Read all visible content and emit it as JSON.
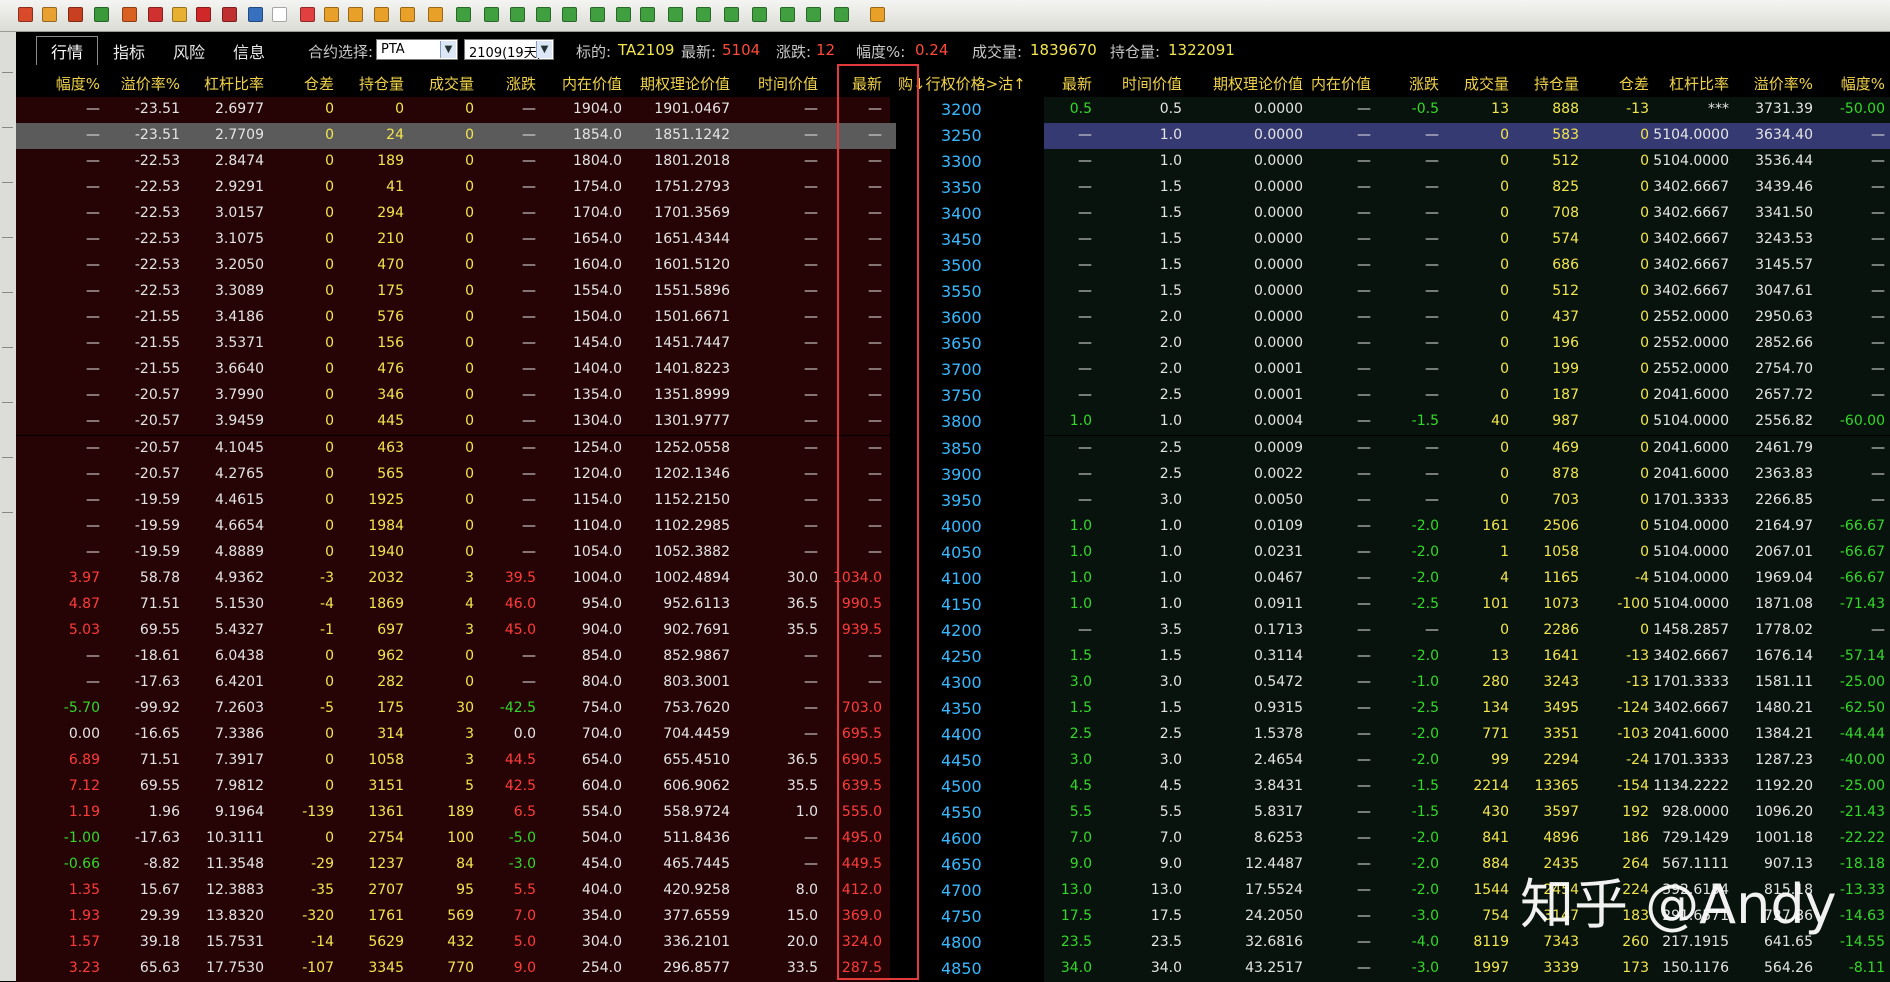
{
  "tabs": [
    "行情",
    "指标",
    "风险",
    "信息"
  ],
  "contract_select": {
    "label": "合约选择:",
    "value": "PTA",
    "expiry": "2109(19天)"
  },
  "underlying": {
    "label": "标的:",
    "value": "TA2109"
  },
  "latest": {
    "label": "最新:",
    "value": "5104"
  },
  "change": {
    "label": "涨跌:",
    "value": "12"
  },
  "amplitude": {
    "label": "幅度%:",
    "value": "0.24"
  },
  "volume": {
    "label": "成交量:",
    "value": "1839670"
  },
  "open_interest": {
    "label": "持仓量:",
    "value": "1322091"
  },
  "colors": {
    "accent_blue": "#38b8ff",
    "header_yellow": "#f3e64e",
    "up_red": "#ff3c3c",
    "down_green": "#34d82a",
    "call_bg": "#260405",
    "put_bg": "#07130c",
    "highlight_box": "#e23a3a"
  },
  "headers": {
    "call": [
      "幅度%",
      "溢价率%",
      "杠杆比率",
      "仓差",
      "持仓量",
      "成交量",
      "涨跌",
      "内在价值",
      "期权理论价值",
      "时间价值",
      "最新"
    ],
    "middle": "购↓行权价格>沽↑",
    "put": [
      "最新",
      "时间价值",
      "期权理论价值",
      "内在价值",
      "涨跌",
      "成交量",
      "持仓量",
      "仓差",
      "杠杆比率",
      "溢价率%",
      "幅度%"
    ]
  },
  "rows": [
    {
      "strike": "3200",
      "call": [
        "—",
        "-23.51",
        "2.6977",
        "0",
        "0",
        "0",
        "—",
        "1904.0",
        "1901.0467",
        "—",
        "—"
      ],
      "put": [
        "0.5",
        "0.5",
        "0.0000",
        "—",
        "-0.5",
        "13",
        "888",
        "-13",
        "***",
        "3731.39",
        "-50.00"
      ]
    },
    {
      "strike": "3250",
      "call": [
        "—",
        "-23.51",
        "2.7709",
        "0",
        "24",
        "0",
        "—",
        "1854.0",
        "1851.1242",
        "—",
        "—"
      ],
      "put": [
        "—",
        "1.0",
        "0.0000",
        "—",
        "—",
        "0",
        "583",
        "0",
        "5104.0000",
        "3634.40",
        "—"
      ]
    },
    {
      "strike": "3300",
      "call": [
        "—",
        "-22.53",
        "2.8474",
        "0",
        "189",
        "0",
        "—",
        "1804.0",
        "1801.2018",
        "—",
        "—"
      ],
      "put": [
        "—",
        "1.0",
        "0.0000",
        "—",
        "—",
        "0",
        "512",
        "0",
        "5104.0000",
        "3536.44",
        "—"
      ]
    },
    {
      "strike": "3350",
      "call": [
        "—",
        "-22.53",
        "2.9291",
        "0",
        "41",
        "0",
        "—",
        "1754.0",
        "1751.2793",
        "—",
        "—"
      ],
      "put": [
        "—",
        "1.5",
        "0.0000",
        "—",
        "—",
        "0",
        "825",
        "0",
        "3402.6667",
        "3439.46",
        "—"
      ]
    },
    {
      "strike": "3400",
      "call": [
        "—",
        "-22.53",
        "3.0157",
        "0",
        "294",
        "0",
        "—",
        "1704.0",
        "1701.3569",
        "—",
        "—"
      ],
      "put": [
        "—",
        "1.5",
        "0.0000",
        "—",
        "—",
        "0",
        "708",
        "0",
        "3402.6667",
        "3341.50",
        "—"
      ]
    },
    {
      "strike": "3450",
      "call": [
        "—",
        "-22.53",
        "3.1075",
        "0",
        "210",
        "0",
        "—",
        "1654.0",
        "1651.4344",
        "—",
        "—"
      ],
      "put": [
        "—",
        "1.5",
        "0.0000",
        "—",
        "—",
        "0",
        "574",
        "0",
        "3402.6667",
        "3243.53",
        "—"
      ]
    },
    {
      "strike": "3500",
      "call": [
        "—",
        "-22.53",
        "3.2050",
        "0",
        "470",
        "0",
        "—",
        "1604.0",
        "1601.5120",
        "—",
        "—"
      ],
      "put": [
        "—",
        "1.5",
        "0.0000",
        "—",
        "—",
        "0",
        "686",
        "0",
        "3402.6667",
        "3145.57",
        "—"
      ]
    },
    {
      "strike": "3550",
      "call": [
        "—",
        "-22.53",
        "3.3089",
        "0",
        "175",
        "0",
        "—",
        "1554.0",
        "1551.5896",
        "—",
        "—"
      ],
      "put": [
        "—",
        "1.5",
        "0.0000",
        "—",
        "—",
        "0",
        "512",
        "0",
        "3402.6667",
        "3047.61",
        "—"
      ]
    },
    {
      "strike": "3600",
      "call": [
        "—",
        "-21.55",
        "3.4186",
        "0",
        "576",
        "0",
        "—",
        "1504.0",
        "1501.6671",
        "—",
        "—"
      ],
      "put": [
        "—",
        "2.0",
        "0.0000",
        "—",
        "—",
        "0",
        "437",
        "0",
        "2552.0000",
        "2950.63",
        "—"
      ]
    },
    {
      "strike": "3650",
      "call": [
        "—",
        "-21.55",
        "3.5371",
        "0",
        "156",
        "0",
        "—",
        "1454.0",
        "1451.7447",
        "—",
        "—"
      ],
      "put": [
        "—",
        "2.0",
        "0.0000",
        "—",
        "—",
        "0",
        "196",
        "0",
        "2552.0000",
        "2852.66",
        "—"
      ]
    },
    {
      "strike": "3700",
      "call": [
        "—",
        "-21.55",
        "3.6640",
        "0",
        "476",
        "0",
        "—",
        "1404.0",
        "1401.8223",
        "—",
        "—"
      ],
      "put": [
        "—",
        "2.0",
        "0.0001",
        "—",
        "—",
        "0",
        "199",
        "0",
        "2552.0000",
        "2754.70",
        "—"
      ]
    },
    {
      "strike": "3750",
      "call": [
        "—",
        "-20.57",
        "3.7990",
        "0",
        "346",
        "0",
        "—",
        "1354.0",
        "1351.8999",
        "—",
        "—"
      ],
      "put": [
        "—",
        "2.5",
        "0.0001",
        "—",
        "—",
        "0",
        "187",
        "0",
        "2041.6000",
        "2657.72",
        "—"
      ]
    },
    {
      "strike": "3800",
      "call": [
        "—",
        "-20.57",
        "3.9459",
        "0",
        "445",
        "0",
        "—",
        "1304.0",
        "1301.9777",
        "—",
        "—"
      ],
      "put": [
        "1.0",
        "1.0",
        "0.0004",
        "—",
        "-1.5",
        "40",
        "987",
        "0",
        "5104.0000",
        "2556.82",
        "-60.00"
      ]
    },
    {
      "strike": "3850",
      "call": [
        "—",
        "-20.57",
        "4.1045",
        "0",
        "463",
        "0",
        "—",
        "1254.0",
        "1252.0558",
        "—",
        "—"
      ],
      "put": [
        "—",
        "2.5",
        "0.0009",
        "—",
        "—",
        "0",
        "469",
        "0",
        "2041.6000",
        "2461.79",
        "—"
      ]
    },
    {
      "strike": "3900",
      "call": [
        "—",
        "-20.57",
        "4.2765",
        "0",
        "565",
        "0",
        "—",
        "1204.0",
        "1202.1346",
        "—",
        "—"
      ],
      "put": [
        "—",
        "2.5",
        "0.0022",
        "—",
        "—",
        "0",
        "878",
        "0",
        "2041.6000",
        "2363.83",
        "—"
      ]
    },
    {
      "strike": "3950",
      "call": [
        "—",
        "-19.59",
        "4.4615",
        "0",
        "1925",
        "0",
        "—",
        "1154.0",
        "1152.2150",
        "—",
        "—"
      ],
      "put": [
        "—",
        "3.0",
        "0.0050",
        "—",
        "—",
        "0",
        "703",
        "0",
        "1701.3333",
        "2266.85",
        "—"
      ]
    },
    {
      "strike": "4000",
      "call": [
        "—",
        "-19.59",
        "4.6654",
        "0",
        "1984",
        "0",
        "—",
        "1104.0",
        "1102.2985",
        "—",
        "—"
      ],
      "put": [
        "1.0",
        "1.0",
        "0.0109",
        "—",
        "-2.0",
        "161",
        "2506",
        "0",
        "5104.0000",
        "2164.97",
        "-66.67"
      ]
    },
    {
      "strike": "4050",
      "call": [
        "—",
        "-19.59",
        "4.8889",
        "0",
        "1940",
        "0",
        "—",
        "1054.0",
        "1052.3882",
        "—",
        "—"
      ],
      "put": [
        "1.0",
        "1.0",
        "0.0231",
        "—",
        "-2.0",
        "1",
        "1058",
        "0",
        "5104.0000",
        "2067.01",
        "-66.67"
      ]
    },
    {
      "strike": "4100",
      "call": [
        "3.97",
        "58.78",
        "4.9362",
        "-3",
        "2032",
        "3",
        "39.5",
        "1004.0",
        "1002.4894",
        "30.0",
        "1034.0"
      ],
      "put": [
        "1.0",
        "1.0",
        "0.0467",
        "—",
        "-2.0",
        "4",
        "1165",
        "-4",
        "5104.0000",
        "1969.04",
        "-66.67"
      ]
    },
    {
      "strike": "4150",
      "call": [
        "4.87",
        "71.51",
        "5.1530",
        "-4",
        "1869",
        "4",
        "46.0",
        "954.0",
        "952.6113",
        "36.5",
        "990.5"
      ],
      "put": [
        "1.0",
        "1.0",
        "0.0911",
        "—",
        "-2.5",
        "101",
        "1073",
        "-100",
        "5104.0000",
        "1871.08",
        "-71.43"
      ]
    },
    {
      "strike": "4200",
      "call": [
        "5.03",
        "69.55",
        "5.4327",
        "-1",
        "697",
        "3",
        "45.0",
        "904.0",
        "902.7691",
        "35.5",
        "939.5"
      ],
      "put": [
        "—",
        "3.5",
        "0.1713",
        "—",
        "—",
        "0",
        "2286",
        "0",
        "1458.2857",
        "1778.02",
        "—"
      ]
    },
    {
      "strike": "4250",
      "call": [
        "—",
        "-18.61",
        "6.0438",
        "0",
        "962",
        "0",
        "—",
        "854.0",
        "852.9867",
        "—",
        "—"
      ],
      "put": [
        "1.5",
        "1.5",
        "0.3114",
        "—",
        "-2.0",
        "13",
        "1641",
        "-13",
        "3402.6667",
        "1676.14",
        "-57.14"
      ]
    },
    {
      "strike": "4300",
      "call": [
        "—",
        "-17.63",
        "6.4201",
        "0",
        "282",
        "0",
        "—",
        "804.0",
        "803.3001",
        "—",
        "—"
      ],
      "put": [
        "3.0",
        "3.0",
        "0.5472",
        "—",
        "-1.0",
        "280",
        "3243",
        "-13",
        "1701.3333",
        "1581.11",
        "-25.00"
      ]
    },
    {
      "strike": "4350",
      "call": [
        "-5.70",
        "-99.92",
        "7.2603",
        "-5",
        "175",
        "30",
        "-42.5",
        "754.0",
        "753.7620",
        "—",
        "703.0"
      ],
      "put": [
        "1.5",
        "1.5",
        "0.9315",
        "—",
        "-2.5",
        "134",
        "3495",
        "-124",
        "3402.6667",
        "1480.21",
        "-62.50"
      ]
    },
    {
      "strike": "4400",
      "call": [
        "0.00",
        "-16.65",
        "7.3386",
        "0",
        "314",
        "3",
        "0.0",
        "704.0",
        "704.4459",
        "—",
        "695.5"
      ],
      "put": [
        "2.5",
        "2.5",
        "1.5378",
        "—",
        "-2.0",
        "771",
        "3351",
        "-103",
        "2041.6000",
        "1384.21",
        "-44.44"
      ]
    },
    {
      "strike": "4450",
      "call": [
        "6.89",
        "71.51",
        "7.3917",
        "0",
        "1058",
        "3",
        "44.5",
        "654.0",
        "655.4510",
        "36.5",
        "690.5"
      ],
      "put": [
        "3.0",
        "3.0",
        "2.4654",
        "—",
        "-2.0",
        "99",
        "2294",
        "-24",
        "1701.3333",
        "1287.23",
        "-40.00"
      ]
    },
    {
      "strike": "4500",
      "call": [
        "7.12",
        "69.55",
        "7.9812",
        "0",
        "3151",
        "5",
        "42.5",
        "604.0",
        "606.9062",
        "35.5",
        "639.5"
      ],
      "put": [
        "4.5",
        "4.5",
        "3.8431",
        "—",
        "-1.5",
        "2214",
        "13365",
        "-154",
        "1134.2222",
        "1192.20",
        "-25.00"
      ]
    },
    {
      "strike": "4550",
      "call": [
        "1.19",
        "1.96",
        "9.1964",
        "-139",
        "1361",
        "189",
        "6.5",
        "554.0",
        "558.9724",
        "1.0",
        "555.0"
      ],
      "put": [
        "5.5",
        "5.5",
        "5.8317",
        "—",
        "-1.5",
        "430",
        "3597",
        "192",
        "928.0000",
        "1096.20",
        "-21.43"
      ]
    },
    {
      "strike": "4600",
      "call": [
        "-1.00",
        "-17.63",
        "10.3111",
        "0",
        "2754",
        "100",
        "-5.0",
        "504.0",
        "511.8436",
        "—",
        "495.0"
      ],
      "put": [
        "7.0",
        "7.0",
        "8.6253",
        "—",
        "-2.0",
        "841",
        "4896",
        "186",
        "729.1429",
        "1001.18",
        "-22.22"
      ]
    },
    {
      "strike": "4650",
      "call": [
        "-0.66",
        "-8.82",
        "11.3548",
        "-29",
        "1237",
        "84",
        "-3.0",
        "454.0",
        "465.7445",
        "—",
        "449.5"
      ],
      "put": [
        "9.0",
        "9.0",
        "12.4487",
        "—",
        "-2.0",
        "884",
        "2435",
        "264",
        "567.1111",
        "907.13",
        "-18.18"
      ]
    },
    {
      "strike": "4700",
      "call": [
        "1.35",
        "15.67",
        "12.3883",
        "-35",
        "2707",
        "95",
        "5.5",
        "404.0",
        "420.9258",
        "8.0",
        "412.0"
      ],
      "put": [
        "13.0",
        "13.0",
        "17.5524",
        "—",
        "-2.0",
        "1544",
        "2454",
        "224",
        "392.6154",
        "815.18",
        "-13.33"
      ]
    },
    {
      "strike": "4750",
      "call": [
        "1.93",
        "29.39",
        "13.8320",
        "-320",
        "1761",
        "569",
        "7.0",
        "354.0",
        "377.6559",
        "15.0",
        "369.0"
      ],
      "put": [
        "17.5",
        "17.5",
        "24.2050",
        "—",
        "-3.0",
        "754",
        "3147",
        "183",
        "291.6571",
        "727.86",
        "-14.63"
      ]
    },
    {
      "strike": "4800",
      "call": [
        "1.57",
        "39.18",
        "15.7531",
        "-14",
        "5629",
        "432",
        "5.0",
        "304.0",
        "336.2101",
        "20.0",
        "324.0"
      ],
      "put": [
        "23.5",
        "23.5",
        "32.6816",
        "—",
        "-4.0",
        "8119",
        "7343",
        "260",
        "217.1915",
        "641.65",
        "-14.55"
      ]
    },
    {
      "strike": "4850",
      "call": [
        "3.23",
        "65.63",
        "17.7530",
        "-107",
        "3345",
        "770",
        "9.0",
        "254.0",
        "296.8577",
        "33.5",
        "287.5"
      ],
      "put": [
        "34.0",
        "34.0",
        "43.2517",
        "—",
        "-3.0",
        "1997",
        "3339",
        "173",
        "150.1176",
        "564.26",
        "-8.11"
      ]
    }
  ],
  "watermark": "知乎 @Andy"
}
